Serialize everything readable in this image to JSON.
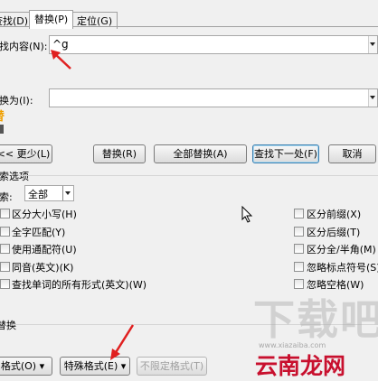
{
  "tabs": [
    {
      "label": "查找(D)"
    },
    {
      "label": "替换(P)"
    },
    {
      "label": "定位(G)"
    }
  ],
  "find": {
    "label": "查找内容(N):",
    "value": "^g"
  },
  "replace": {
    "label": "替换为(I):",
    "value": ""
  },
  "left_hint": "替",
  "buttons": {
    "less": "<< 更少(L)",
    "replace": "替换(R)",
    "replace_all": "全部替换(A)",
    "find_next": "查找下一处(F)",
    "cancel": "取消",
    "format": "格式(O) ▾",
    "special": "特殊格式(E) ▾",
    "no_format": "不限定格式(T)"
  },
  "search_options": {
    "group_label": "搜索选项",
    "search_label": "搜索:",
    "search_value": "全部"
  },
  "left_options": [
    "区分大小写(H)",
    "全字匹配(Y)",
    "使用通配符(U)",
    "同音(英文)(K)",
    "查找单词的所有形式(英文)(W)"
  ],
  "right_options": [
    "区分前缀(X)",
    "区分后缀(T)",
    "区分全/半角(M)",
    "忽略标点符号(S)",
    "忽略空格(W)"
  ],
  "replace_group": "替换",
  "watermark": {
    "brand": "下载吧",
    "site": "云南龙网",
    "url": "www.xiazaiba.com"
  },
  "colors": {
    "arrow": "#e02020",
    "hint": "#f0a000",
    "watermark_red": "#c8102e"
  }
}
